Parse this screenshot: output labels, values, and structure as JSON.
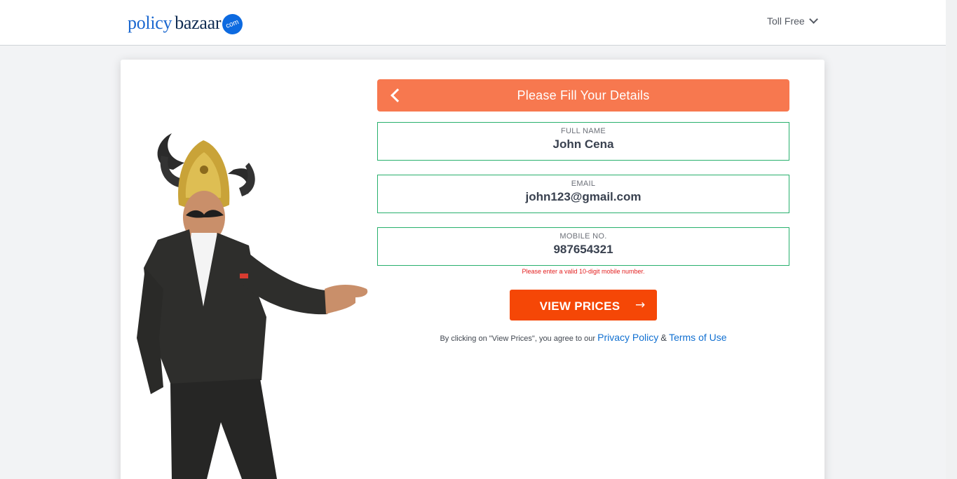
{
  "header": {
    "logo": {
      "part1": "policy",
      "part2": "bazaar",
      "badge": "com"
    },
    "toll_free_label": "Toll Free",
    "chevron_icon": "chevron-down-icon"
  },
  "form": {
    "title": "Please Fill Your Details",
    "back_icon": "chevron-left-icon",
    "fields": {
      "full_name": {
        "label": "FULL NAME",
        "value": "John Cena"
      },
      "email": {
        "label": "EMAIL",
        "value": "john123@gmail.com"
      },
      "mobile": {
        "label": "MOBILE NO.",
        "value": "987654321"
      }
    },
    "error": "Please enter a valid 10-digit mobile number.",
    "submit_label": "VIEW PRICES",
    "submit_arrow": "→",
    "terms": {
      "prefix": "By clicking on \"View Prices\", you agree to our",
      "privacy": "Privacy Policy",
      "amp": "&",
      "terms_of_use": "Terms of Use"
    }
  },
  "colors": {
    "brand_blue": "#1a67cf",
    "banner_orange": "#f7784f",
    "cta_orange": "#f54706",
    "field_border_green": "#28b06d",
    "error_red": "#e32020"
  }
}
